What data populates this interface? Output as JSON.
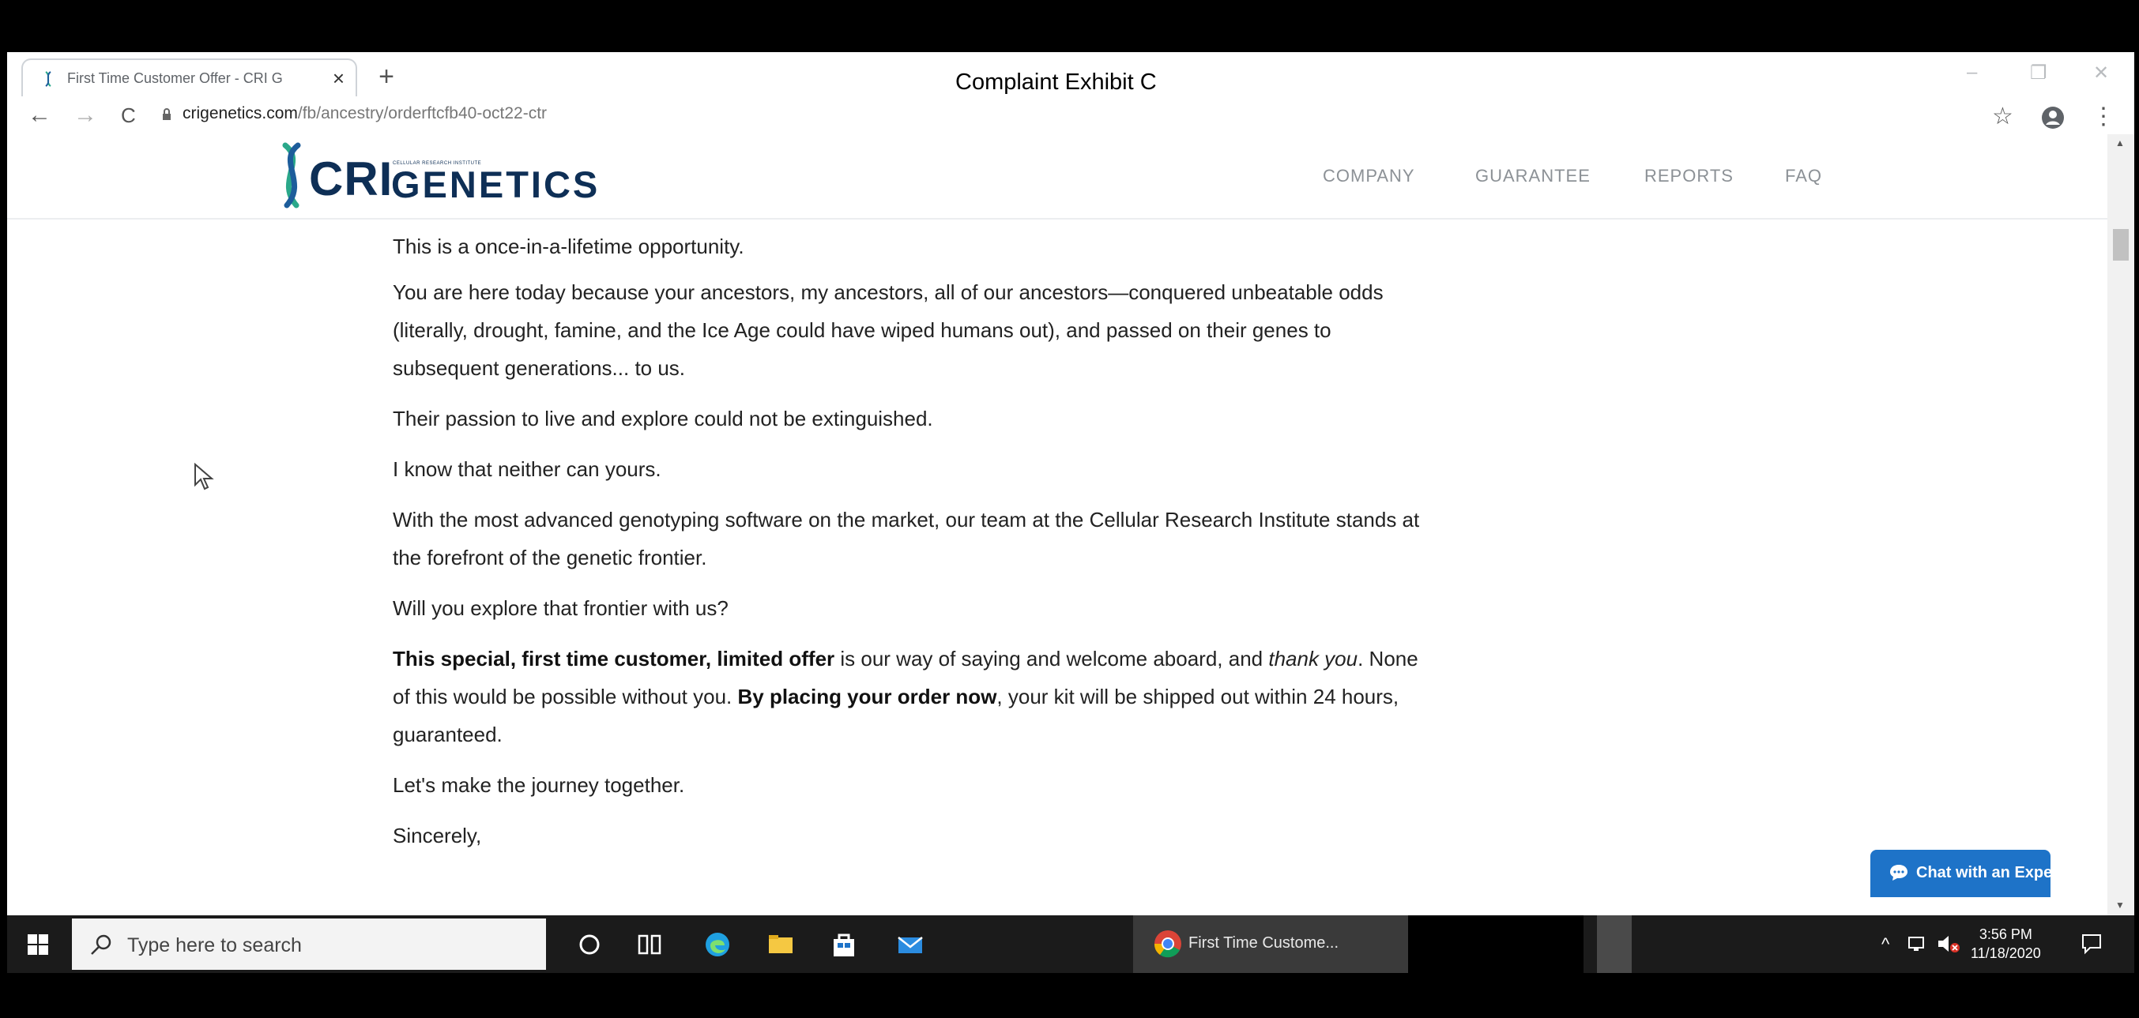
{
  "browser": {
    "tab_title": "First Time Customer Offer - CRI G",
    "tab_close": "×",
    "new_tab": "+",
    "overlay_caption": "Complaint Exhibit C",
    "url_domain": "crigenetics.com",
    "url_path": "/fb/ancestry/orderftcfb40-oct22-ctr",
    "nav_back": "←",
    "nav_forward": "→",
    "nav_reload": "C",
    "win_minimize": "–",
    "win_restore": "❐",
    "win_close": "✕",
    "bookmark_star": "☆",
    "menu_dots": "⋮"
  },
  "site": {
    "logo_cri": "CRI",
    "logo_genetics": "GENETICS",
    "logo_tagline": "CELLULAR RESEARCH INSTITUTE",
    "nav": [
      "COMPANY",
      "GUARANTEE",
      "REPORTS",
      "FAQ"
    ]
  },
  "content": {
    "p1": "This is a once-in-a-lifetime opportunity.",
    "p2": "You are here today because your ancestors, my ancestors, all of our ancestors—conquered unbeatable odds (literally, drought, famine, and the Ice Age could have wiped humans out), and passed on their genes to subsequent generations... to us.",
    "p3": "Their passion to live and explore could not be extinguished.",
    "p4": "I know that neither can yours.",
    "p5": "With the most advanced genotyping software on the market, our team at the Cellular Research Institute stands at the forefront of the genetic frontier.",
    "p6": "Will you explore that frontier with us?",
    "p7_bold1": "This special, first time customer, limited offer",
    "p7_text1": " is our way of saying and welcome aboard, and ",
    "p7_italic": "thank you",
    "p7_text2": ". None of this would be possible without you. ",
    "p7_bold2": "By placing your order now",
    "p7_text3": ", your kit will be shipped out within 24 hours, guaranteed.",
    "p8": "Let's make the journey together.",
    "p9": "Sincerely,"
  },
  "chat": {
    "label": "Chat with an Expert"
  },
  "taskbar": {
    "search_placeholder": "Type here to search",
    "chrome_task_label": "First Time Custome...",
    "tray_chevron": "^",
    "clock_time": "3:56 PM",
    "clock_date": "11/18/2020"
  },
  "colors": {
    "brand_navy": "#0e2f56",
    "chat_blue": "#1e73c8",
    "taskbar": "#1b1b1b"
  }
}
